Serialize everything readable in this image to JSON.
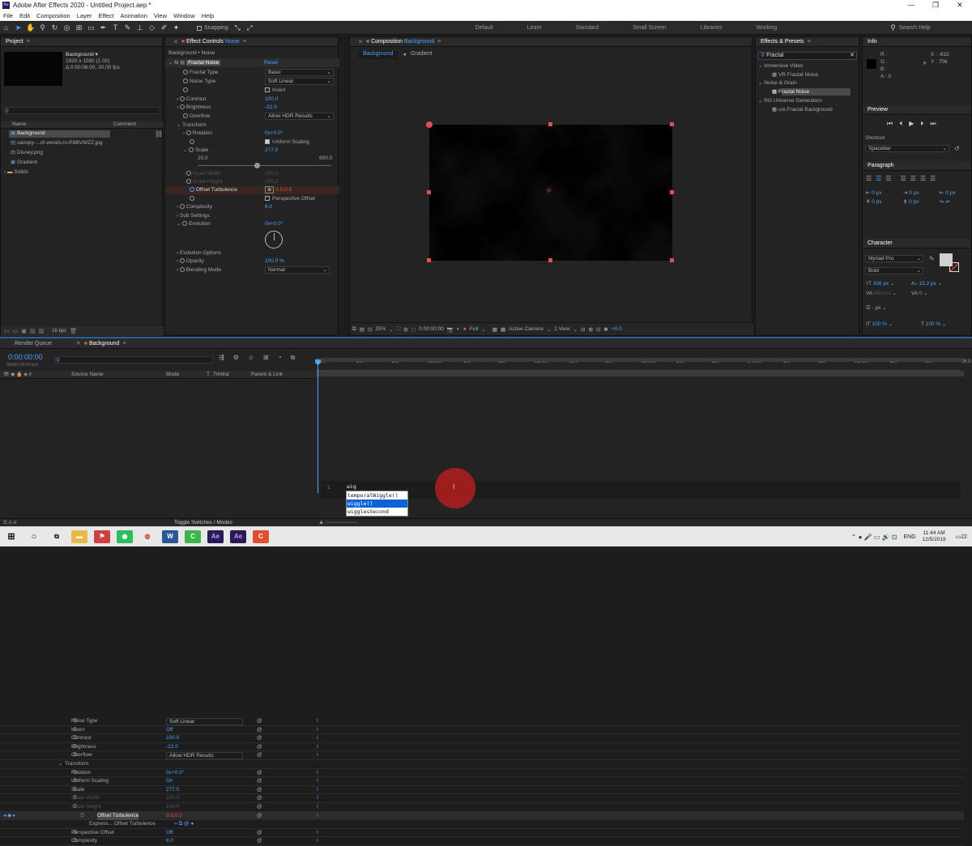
{
  "window": {
    "title": "Adobe After Effects 2020 - Untitled Project.aep *",
    "controls": [
      "—",
      "❐",
      "✕"
    ]
  },
  "menu": [
    "File",
    "Edit",
    "Composition",
    "Layer",
    "Effect",
    "Animation",
    "View",
    "Window",
    "Help"
  ],
  "toolbar": {
    "snapping": "Snapping",
    "workspaces": [
      "Default",
      "Learn",
      "Standard",
      "Small Screen",
      "Libraries",
      "Working"
    ],
    "search_placeholder": "Search Help"
  },
  "project": {
    "title": "Project",
    "selected": {
      "name": "Background ▾",
      "size": "1920 x 1080 (1.00)",
      "duration": "Δ 0:00:06:00, 30.00 fps"
    },
    "columns": [
      "Name",
      "Comment"
    ],
    "items": [
      "Background",
      "canopy-...of-woods-in-P8BVWZZ.jpg",
      "Disney.png",
      "Gradient",
      "Solids"
    ],
    "bpc": "16 bpc"
  },
  "effect_controls": {
    "title": "Effect Controls",
    "layer": "Noise",
    "breadcrumb": "Background • Noise",
    "effect_name": "Fractal Noise",
    "reset": "Reset",
    "props": [
      {
        "label": "Fractal Type",
        "value": "Basic"
      },
      {
        "label": "Noise Type",
        "value": "Soft Linear"
      },
      {
        "label": "",
        "value": "Invert"
      },
      {
        "label": "Contrast",
        "value": "100.0"
      },
      {
        "label": "Brightness",
        "value": "-22.0"
      },
      {
        "label": "Overflow",
        "value": "Allow HDR Results"
      }
    ],
    "transform": "Transform",
    "rotation": {
      "label": "Rotation",
      "value": "0x+0.0°"
    },
    "uniform_scaling": "Uniform Scaling",
    "scale": {
      "label": "Scale",
      "value": "277.0",
      "min": "20.0",
      "max": "600.0",
      "fraction": 0.44
    },
    "scale_width": {
      "label": "Scale Width",
      "value": "100.0"
    },
    "scale_height": {
      "label": "Scale Height",
      "value": "100.0"
    },
    "offset_turbulence": {
      "label": "Offset Turbulence",
      "value": "0.0,0.0"
    },
    "perspective_offset": "Perspective Offset",
    "complexity": {
      "label": "Complexity",
      "value": "6.0"
    },
    "sub_settings": "Sub Settings",
    "evolution": {
      "label": "Evolution",
      "value": "0x+0.0°"
    },
    "evolution_options": "Evolution Options",
    "opacity": {
      "label": "Opacity",
      "value": "100.0 %"
    },
    "blending": {
      "label": "Blending Mode",
      "value": "Normal"
    }
  },
  "composition": {
    "title": "Composition",
    "name": "Background",
    "tabs": [
      "Background",
      "Gradient"
    ],
    "footer": {
      "zoom": "25%",
      "timecode": "0:00:00:00",
      "resolution": "Full",
      "camera": "Active Camera",
      "view": "1 View",
      "exposure": "+0.0"
    }
  },
  "effects_presets": {
    "title": "Effects & Presets",
    "search": "Fractal",
    "groups": [
      {
        "name": "Immersive Video",
        "items": [
          "VR Fractal Noise"
        ]
      },
      {
        "name": "Noise & Grain",
        "items": [
          "Fractal Noise"
        ]
      },
      {
        "name": "RG Universe Generators",
        "items": [
          "uni.Fractal Background"
        ]
      }
    ]
  },
  "info": {
    "title": "Info",
    "r": "R :",
    "g": "G :",
    "b": "B :",
    "a": "A : 0",
    "x": "X : -632",
    "y": "Y : 756"
  },
  "preview": {
    "title": "Preview",
    "shortcut_label": "Shortcut",
    "shortcut": "Spacebar"
  },
  "paragraph": {
    "title": "Paragraph",
    "values": [
      "0 px",
      "0 px",
      "0 px",
      "0 px",
      "0 px"
    ]
  },
  "character": {
    "title": "Character",
    "font": "Myriad Pro",
    "style": "Bold",
    "size": "336 px",
    "leading": "15.3 px",
    "kerning": "Metrics",
    "tracking": "0",
    "unit": "- px",
    "vscale": "100 %",
    "hscale": "100 %"
  },
  "timeline": {
    "tabs": [
      "Render Queue",
      "Background"
    ],
    "timecode": "0:00:00:00",
    "timecode_sub": "00000 (30.00 fps)",
    "columns": [
      "Source Name",
      "Mode",
      "T",
      "TrkMat",
      "Parent & Link"
    ],
    "ruler": [
      "0f",
      "10f",
      "20f",
      "01:00f",
      "10f",
      "20f",
      "02:00f",
      "10f",
      "20f",
      "03:00f",
      "10f",
      "20f",
      "04:00f",
      "10f",
      "20f",
      "05:00f",
      "10f",
      "20f",
      "06:0"
    ],
    "rows": [
      {
        "name": "Noise Type",
        "value": "Soft Linear",
        "type": "dd"
      },
      {
        "name": "Invert",
        "value": "Off",
        "type": "val"
      },
      {
        "name": "Contrast",
        "value": "100.0",
        "type": "val"
      },
      {
        "name": "Brightness",
        "value": "-22.0",
        "type": "val"
      },
      {
        "name": "Overflow",
        "value": "Allow HDR Results",
        "type": "dd"
      },
      {
        "name": "Transform",
        "value": "",
        "type": "group"
      },
      {
        "name": "Rotation",
        "value": "0x+0.0°",
        "type": "val"
      },
      {
        "name": "Uniform Scaling",
        "value": "On",
        "type": "val"
      },
      {
        "name": "Scale",
        "value": "277.0",
        "type": "val"
      },
      {
        "name": "Scale Width",
        "value": "100.0",
        "type": "dim"
      },
      {
        "name": "Scale Height",
        "value": "100.0",
        "type": "dim"
      },
      {
        "name": "Offset Turbulence",
        "value": "0.0,0.0",
        "type": "sel"
      },
      {
        "name": "Express... Offset Turbulence",
        "value": "",
        "type": "expr"
      },
      {
        "name": "Perspective Offset",
        "value": "Off",
        "type": "val"
      },
      {
        "name": "Complexity",
        "value": "6.0",
        "type": "val"
      }
    ],
    "expression": "wig",
    "line_no": "1",
    "autocomplete": [
      "temporalWiggle()",
      "wiggle()",
      "wigglesSecond"
    ],
    "toggle": "Toggle Switches / Modes"
  },
  "taskbar": {
    "time": "11:44 AM",
    "date": "12/5/2019",
    "lang": "ENG",
    "notif": "22"
  }
}
